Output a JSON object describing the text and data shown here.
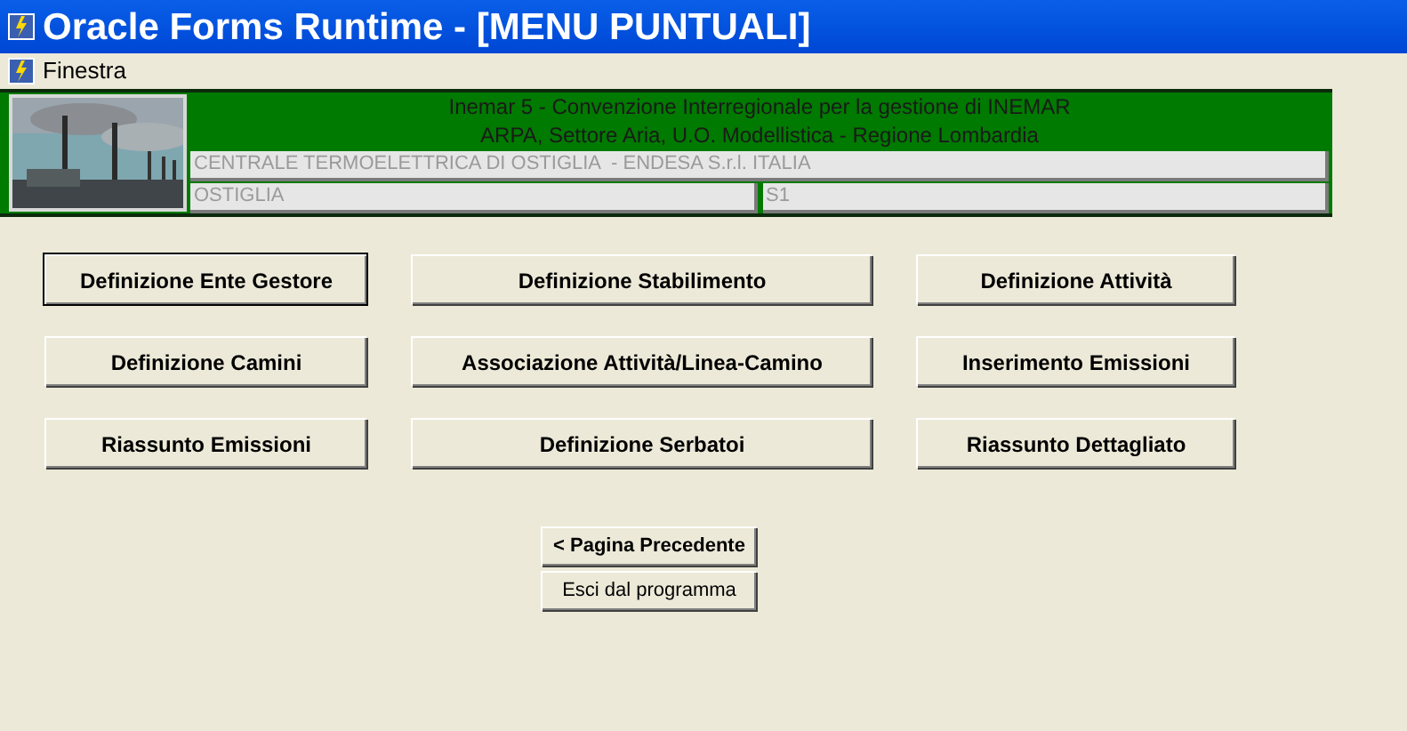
{
  "window": {
    "title": "Oracle Forms Runtime - [MENU PUNTUALI]"
  },
  "menu": [
    "Finestra"
  ],
  "header": {
    "lines": [
      "Inemar 5 - Convenzione Interregionale per la gestione di INEMAR",
      "ARPA, Settore Aria, U.O. Modellistica - Regione Lombardia"
    ],
    "fields": [
      [
        "CENTRALE TERMOELETTRICA DI OSTIGLIA  - ENDESA S.r.l. ITALIA"
      ],
      [
        "OSTIGLIA",
        "S1"
      ]
    ]
  },
  "buttons": [
    {
      "label": "Definizione Ente Gestore",
      "focused": true
    },
    {
      "label": "Definizione Stabilimento",
      "focused": false
    },
    {
      "label": "Definizione Attività",
      "focused": false
    },
    {
      "label": "Definizione Camini",
      "focused": false
    },
    {
      "label": "Associazione Attività/Linea-Camino",
      "focused": false
    },
    {
      "label": "Inserimento Emissioni",
      "focused": false
    },
    {
      "label": "Riassunto Emissioni",
      "focused": false
    },
    {
      "label": "Definizione Serbatoi",
      "focused": false
    },
    {
      "label": "Riassunto Dettagliato",
      "focused": false
    }
  ],
  "nav_buttons": [
    {
      "label": "< Pagina Precedente",
      "bold": true
    },
    {
      "label": "Esci dal programma",
      "bold": false
    }
  ]
}
